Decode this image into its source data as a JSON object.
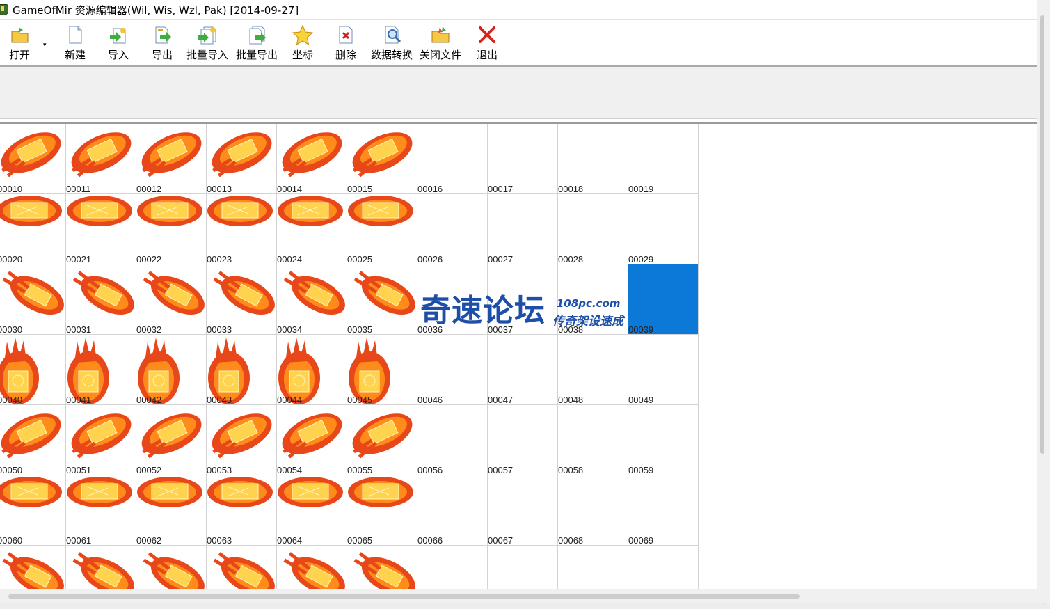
{
  "window": {
    "title": "GameOfMir 资源编辑器(Wil, Wis, Wzl, Pak) [2014-09-27]"
  },
  "toolbar": {
    "buttons": [
      {
        "label": "打开",
        "icon": "open-folder-icon"
      },
      {
        "label": "新建",
        "icon": "new-file-icon"
      },
      {
        "label": "导入",
        "icon": "import-icon"
      },
      {
        "label": "导出",
        "icon": "export-icon"
      },
      {
        "label": "批量导入",
        "icon": "batch-import-icon"
      },
      {
        "label": "批量导出",
        "icon": "batch-export-icon"
      },
      {
        "label": "坐标",
        "icon": "star-icon"
      },
      {
        "label": "删除",
        "icon": "delete-icon"
      },
      {
        "label": "数据转换",
        "icon": "data-convert-icon"
      },
      {
        "label": "关闭文件",
        "icon": "close-file-icon"
      },
      {
        "label": "退出",
        "icon": "exit-icon"
      }
    ],
    "dropdown_arrow": "▾"
  },
  "grid": {
    "selected_index": "00039",
    "rows": [
      {
        "labels": [
          "00010",
          "00011",
          "00012",
          "00013",
          "00014",
          "00015",
          "00016",
          "00017",
          "00018",
          "00019"
        ],
        "effect": "diag-up"
      },
      {
        "labels": [
          "00020",
          "00021",
          "00022",
          "00023",
          "00024",
          "00025",
          "00026",
          "00027",
          "00028",
          "00029"
        ],
        "effect": "horizontal"
      },
      {
        "labels": [
          "00030",
          "00031",
          "00032",
          "00033",
          "00034",
          "00035",
          "00036",
          "00037",
          "00038",
          "00039"
        ],
        "effect": "diag-down"
      },
      {
        "labels": [
          "00040",
          "00041",
          "00042",
          "00043",
          "00044",
          "00045",
          "00046",
          "00047",
          "00048",
          "00049"
        ],
        "effect": "vertical"
      },
      {
        "labels": [
          "00050",
          "00051",
          "00052",
          "00053",
          "00054",
          "00055",
          "00056",
          "00057",
          "00058",
          "00059"
        ],
        "effect": "diag-up"
      },
      {
        "labels": [
          "00060",
          "00061",
          "00062",
          "00063",
          "00064",
          "00065",
          "00066",
          "00067",
          "00068",
          "00069"
        ],
        "effect": "horizontal"
      },
      {
        "labels": [
          "",
          "",
          "",
          "",
          "",
          "",
          "",
          "",
          "",
          ""
        ],
        "effect": "diag-down"
      }
    ]
  },
  "watermark": {
    "main": "奇速论坛",
    "domain": "108pc.com",
    "sub": "传奇架设速成"
  },
  "colors": {
    "selection": "#0c79d8",
    "fire_outer": "#e8471a",
    "fire_mid": "#ff8c1a",
    "fire_core": "#ffd34d",
    "watermark": "#1e4fa8"
  }
}
